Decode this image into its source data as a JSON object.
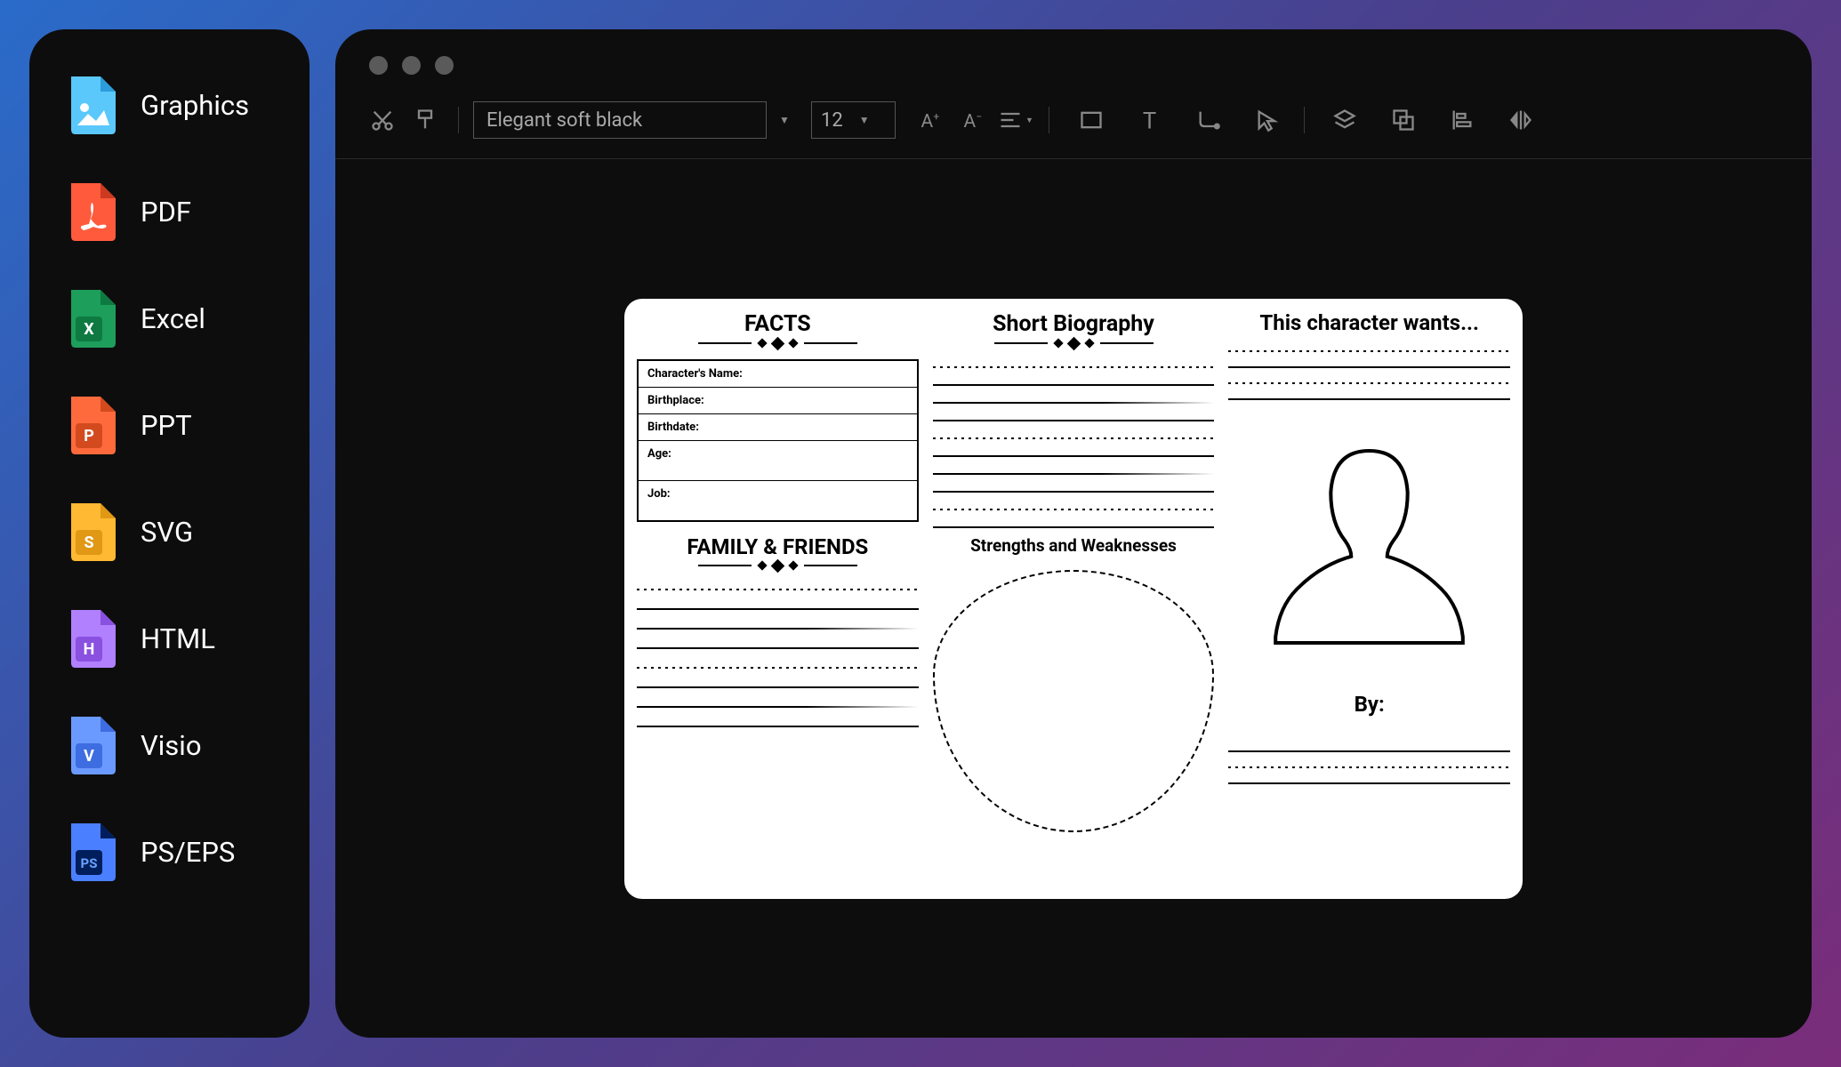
{
  "sidebar": {
    "items": [
      {
        "label": "Graphics"
      },
      {
        "label": "PDF"
      },
      {
        "label": "Excel"
      },
      {
        "label": "PPT"
      },
      {
        "label": "SVG"
      },
      {
        "label": "HTML"
      },
      {
        "label": "Visio"
      },
      {
        "label": "PS/EPS"
      }
    ]
  },
  "toolbar": {
    "font_family": "Elegant soft black",
    "font_size": "12"
  },
  "document": {
    "col1": {
      "heading1": "FACTS",
      "facts": {
        "name_label": "Character's Name:",
        "birthplace_label": "Birthplace:",
        "birthdate_label": "Birthdate:",
        "age_label": "Age:",
        "job_label": "Job:"
      },
      "heading2": "FAMILY & FRIENDS"
    },
    "col2": {
      "heading": "Short Biography",
      "subsection": "Strengths and Weaknesses"
    },
    "col3": {
      "heading": "This character wants...",
      "by_label": "By:"
    }
  }
}
